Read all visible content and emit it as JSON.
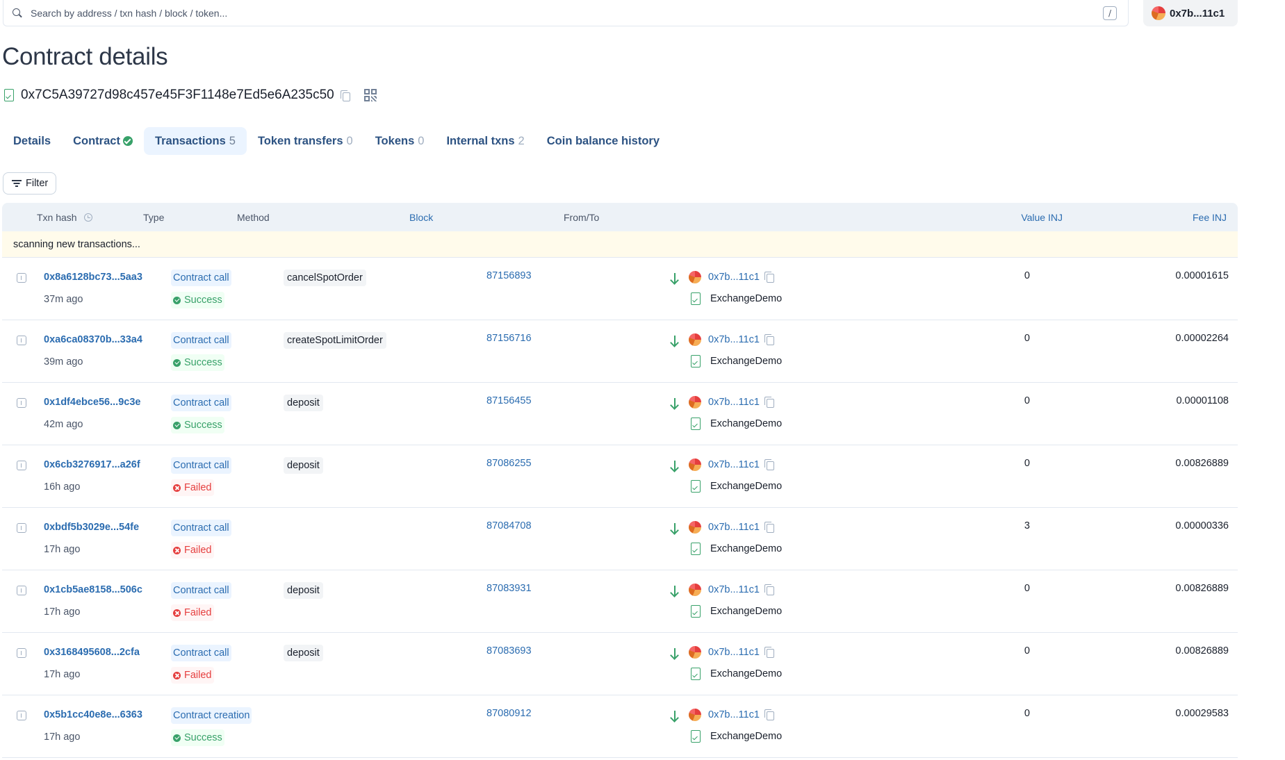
{
  "search": {
    "placeholder": "Search by address / txn hash / block / token...",
    "shortcut": "/"
  },
  "account": {
    "label": "0x7b...11c1"
  },
  "page": {
    "title": "Contract details",
    "address": "0x7C5A39727d98c457e45F3F1148e7Ed5e6A235c50"
  },
  "tabs": [
    {
      "label": "Details",
      "count": ""
    },
    {
      "label": "Contract",
      "count": ""
    },
    {
      "label": "Transactions",
      "count": "5"
    },
    {
      "label": "Token transfers",
      "count": "0"
    },
    {
      "label": "Tokens",
      "count": "0"
    },
    {
      "label": "Internal txns",
      "count": "2"
    },
    {
      "label": "Coin balance history",
      "count": ""
    }
  ],
  "active_tab": "Transactions",
  "filter": {
    "label": "Filter"
  },
  "table": {
    "headers": {
      "txn_hash": "Txn hash",
      "type": "Type",
      "method": "Method",
      "block": "Block",
      "from_to": "From/To",
      "value": "Value INJ",
      "fee": "Fee INJ"
    },
    "scanning_text": "scanning new transactions...",
    "rows": [
      {
        "hash": "0x8a6128bc73...5aa3",
        "age": "37m ago",
        "type": "Contract call",
        "status": "Success",
        "method": "cancelSpotOrder",
        "block": "87156893",
        "from": "0x7b...11c1",
        "to": "ExchangeDemo",
        "value": "0",
        "fee": "0.00001615"
      },
      {
        "hash": "0xa6ca08370b...33a4",
        "age": "39m ago",
        "type": "Contract call",
        "status": "Success",
        "method": "createSpotLimitOrder",
        "block": "87156716",
        "from": "0x7b...11c1",
        "to": "ExchangeDemo",
        "value": "0",
        "fee": "0.00002264"
      },
      {
        "hash": "0x1df4ebce56...9c3e",
        "age": "42m ago",
        "type": "Contract call",
        "status": "Success",
        "method": "deposit",
        "block": "87156455",
        "from": "0x7b...11c1",
        "to": "ExchangeDemo",
        "value": "0",
        "fee": "0.00001108"
      },
      {
        "hash": "0x6cb3276917...a26f",
        "age": "16h ago",
        "type": "Contract call",
        "status": "Failed",
        "method": "deposit",
        "block": "87086255",
        "from": "0x7b...11c1",
        "to": "ExchangeDemo",
        "value": "0",
        "fee": "0.00826889"
      },
      {
        "hash": "0xbdf5b3029e...54fe",
        "age": "17h ago",
        "type": "Contract call",
        "status": "Failed",
        "method": "",
        "block": "87084708",
        "from": "0x7b...11c1",
        "to": "ExchangeDemo",
        "value": "3",
        "fee": "0.00000336"
      },
      {
        "hash": "0x1cb5ae8158...506c",
        "age": "17h ago",
        "type": "Contract call",
        "status": "Failed",
        "method": "deposit",
        "block": "87083931",
        "from": "0x7b...11c1",
        "to": "ExchangeDemo",
        "value": "0",
        "fee": "0.00826889"
      },
      {
        "hash": "0x3168495608...2cfa",
        "age": "17h ago",
        "type": "Contract call",
        "status": "Failed",
        "method": "deposit",
        "block": "87083693",
        "from": "0x7b...11c1",
        "to": "ExchangeDemo",
        "value": "0",
        "fee": "0.00826889"
      },
      {
        "hash": "0x5b1cc40e8e...6363",
        "age": "17h ago",
        "type": "Contract creation",
        "status": "Success",
        "method": "",
        "block": "87080912",
        "from": "0x7b...11c1",
        "to": "ExchangeDemo",
        "value": "0",
        "fee": "0.00029583"
      }
    ]
  },
  "colors": {
    "link": "#2b6cb0",
    "success": "#38a169",
    "failed": "#e53e3e",
    "active_tab_bg": "#ebf4ff",
    "scanning_bg": "#fffbeb"
  }
}
